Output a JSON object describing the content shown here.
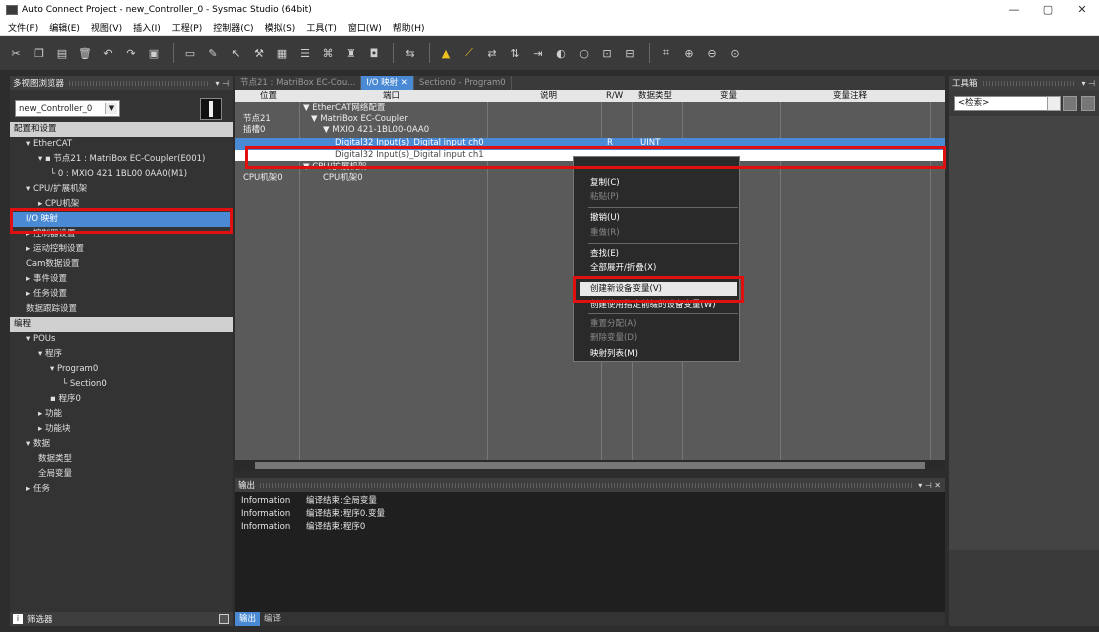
{
  "window": {
    "title": "Auto Connect Project - new_Controller_0 - Sysmac Studio (64bit)",
    "min": "—",
    "max": "▢",
    "close": "✕"
  },
  "menu": [
    "文件(F)",
    "编辑(E)",
    "视图(V)",
    "插入(I)",
    "工程(P)",
    "控制器(C)",
    "模拟(S)",
    "工具(T)",
    "窗口(W)",
    "帮助(H)"
  ],
  "left": {
    "header": "多视图浏览器",
    "controller": "new_Controller_0",
    "footer": "筛选器",
    "tree": [
      {
        "label": "配置和设置",
        "type": "sec",
        "indent": 0
      },
      {
        "label": "▾ EtherCAT",
        "indent": 1
      },
      {
        "label": "▾ ▪ 节点21 : MatriBox EC-Coupler(E001)",
        "indent": 2
      },
      {
        "label": "└ 0 : MXIO 421 1BL00 0AA0(M1)",
        "indent": 3
      },
      {
        "label": "▾ CPU/扩展机架",
        "indent": 1
      },
      {
        "label": "▸ CPU机架",
        "indent": 2
      },
      {
        "label": "I/O 映射",
        "type": "sel",
        "indent": 1
      },
      {
        "label": "▸ 控制器设置",
        "indent": 1
      },
      {
        "label": "▸ 运动控制设置",
        "indent": 1
      },
      {
        "label": "Cam数据设置",
        "indent": 1
      },
      {
        "label": "▸ 事件设置",
        "indent": 1
      },
      {
        "label": "▸ 任务设置",
        "indent": 1
      },
      {
        "label": "数据跟踪设置",
        "indent": 1
      },
      {
        "label": "编程",
        "type": "sec",
        "indent": 0
      },
      {
        "label": "▾ POUs",
        "indent": 1
      },
      {
        "label": "▾ 程序",
        "indent": 2
      },
      {
        "label": "▾ Program0",
        "indent": 3
      },
      {
        "label": "└ Section0",
        "indent": 4
      },
      {
        "label": "▪ 程序0",
        "indent": 3
      },
      {
        "label": "▸ 功能",
        "indent": 2
      },
      {
        "label": "▸ 功能块",
        "indent": 2
      },
      {
        "label": "▾ 数据",
        "indent": 1
      },
      {
        "label": "数据类型",
        "indent": 2
      },
      {
        "label": "全局变量",
        "indent": 2
      },
      {
        "label": "▸ 任务",
        "indent": 1
      }
    ]
  },
  "center": {
    "tabs": [
      "节点21 : MatriBox EC-Cou...",
      "I/O 映射",
      "Section0 - Program0"
    ],
    "columns": [
      "位置",
      "端口",
      "说明",
      "R/W",
      "数据类型",
      "变量",
      "变量注释"
    ],
    "rows": [
      {
        "pos": "",
        "port": "▼ EtherCAT网络配置",
        "rw": "",
        "type": ""
      },
      {
        "pos": "节点21",
        "port": "▼ MatriBox EC-Coupler",
        "rw": "",
        "type": ""
      },
      {
        "pos": "插槽0",
        "port": "▼ MXIO 421-1BL00-0AA0",
        "rw": "",
        "type": ""
      },
      {
        "pos": "",
        "port": "Digital32 Input(s)_Digital input ch0",
        "rw": "R",
        "type": "UINT"
      },
      {
        "pos": "",
        "port": "Digital32 Input(s)_Digital input ch1",
        "rw": "",
        "type": ""
      },
      {
        "pos": "",
        "port": "▼ CPU/扩展机架",
        "rw": "",
        "type": ""
      },
      {
        "pos": "CPU机架0",
        "port": "CPU机架0",
        "rw": "",
        "type": ""
      }
    ]
  },
  "context_menu": {
    "items": [
      {
        "label": "复制(C)",
        "enabled": true
      },
      {
        "label": "粘贴(P)",
        "enabled": false
      },
      {
        "label": "撤销(U)",
        "enabled": true
      },
      {
        "label": "重做(R)",
        "enabled": false
      },
      {
        "label": "查找(E)",
        "enabled": true
      },
      {
        "label": "全部展开/折叠(X)",
        "enabled": true
      },
      {
        "label": "创建新设备变量(V)",
        "enabled": true
      },
      {
        "label": "创建使用指定前缀的设备变量(W)",
        "enabled": true
      },
      {
        "label": "重置分配(A)",
        "enabled": false
      },
      {
        "label": "删除变量(D)",
        "enabled": false
      },
      {
        "label": "映射列表(M)",
        "enabled": true
      }
    ]
  },
  "output": {
    "header": "输出",
    "rows": [
      {
        "type": "Information",
        "msg": "编译结束:全局变量"
      },
      {
        "type": "Information",
        "msg": "编译结束:程序0.变量"
      },
      {
        "type": "Information",
        "msg": "编译结束:程序0"
      }
    ],
    "tabs": [
      "输出",
      "编译"
    ]
  },
  "right": {
    "header": "工具箱",
    "search": "<检索>"
  },
  "highlight_color": "#e01010",
  "selection_color": "#4a8ad4"
}
